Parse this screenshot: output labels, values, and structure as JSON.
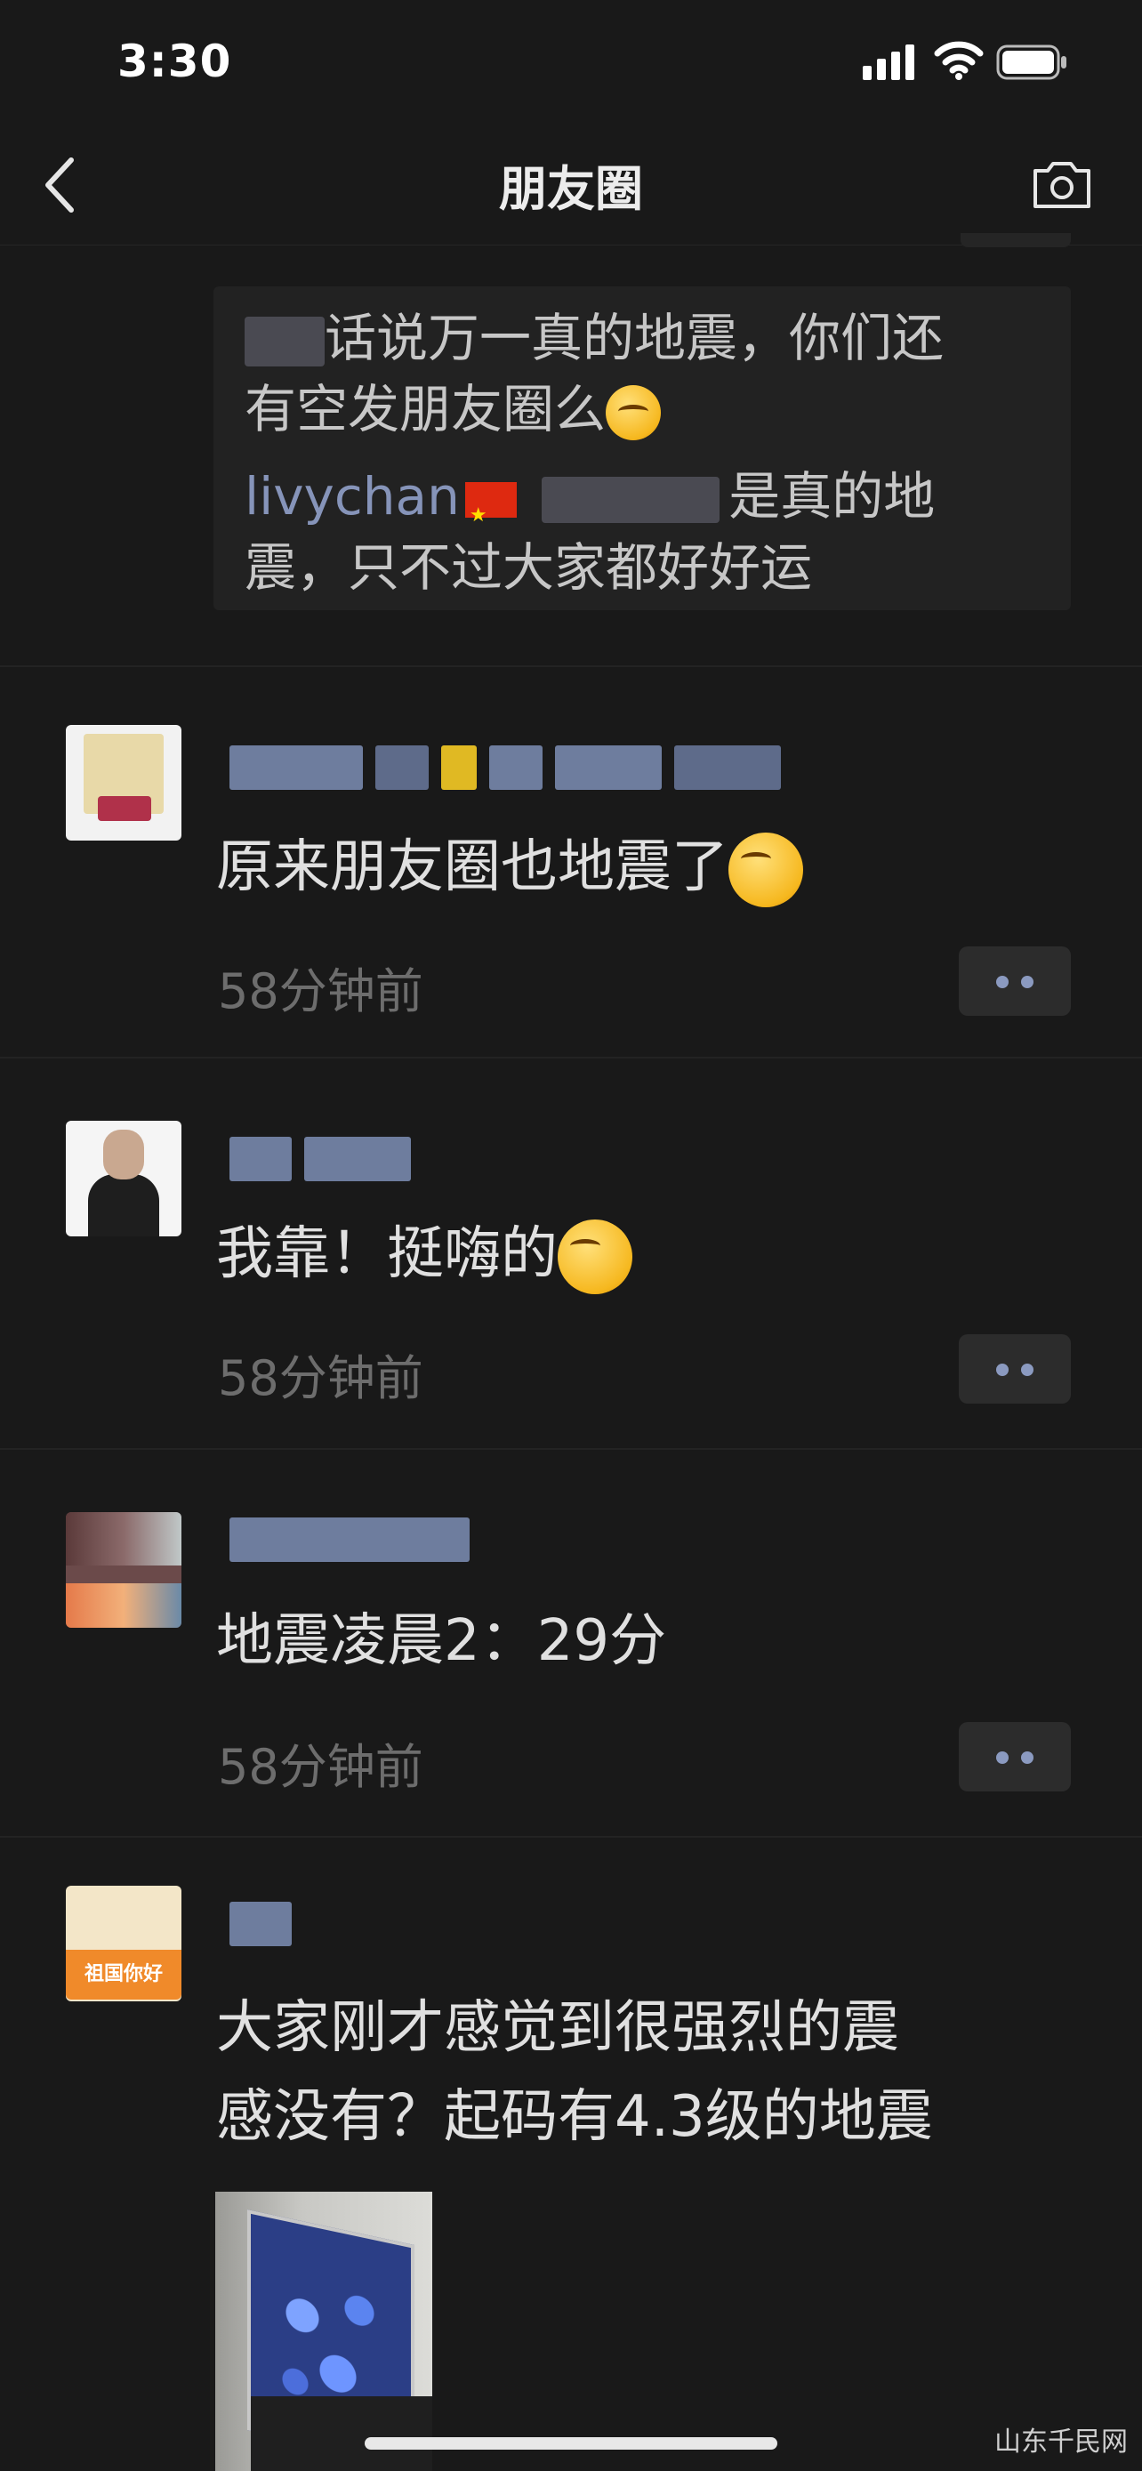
{
  "status_bar": {
    "time": "3:30"
  },
  "nav": {
    "title": "朋友圈"
  },
  "prev_comment": {
    "line1": "话说万一真的地震，你们还",
    "line2": "有空发朋友圈么",
    "reply_name": "livychan",
    "line3_rest": "是真的地",
    "line4": "震，只不过大家都好好运"
  },
  "posts": [
    {
      "text": "原来朋友圈也地震了",
      "time": "58分钟前"
    },
    {
      "text": "我靠！挺嗨的",
      "time": "58分钟前"
    },
    {
      "text": "地震凌晨2：29分",
      "time": "58分钟前"
    },
    {
      "line1": "大家刚才感觉到很强烈的震",
      "line2": "感没有？起码有4.3级的地震"
    }
  ],
  "avatar4_badge": "祖国你好",
  "watermark": "山东千民网"
}
